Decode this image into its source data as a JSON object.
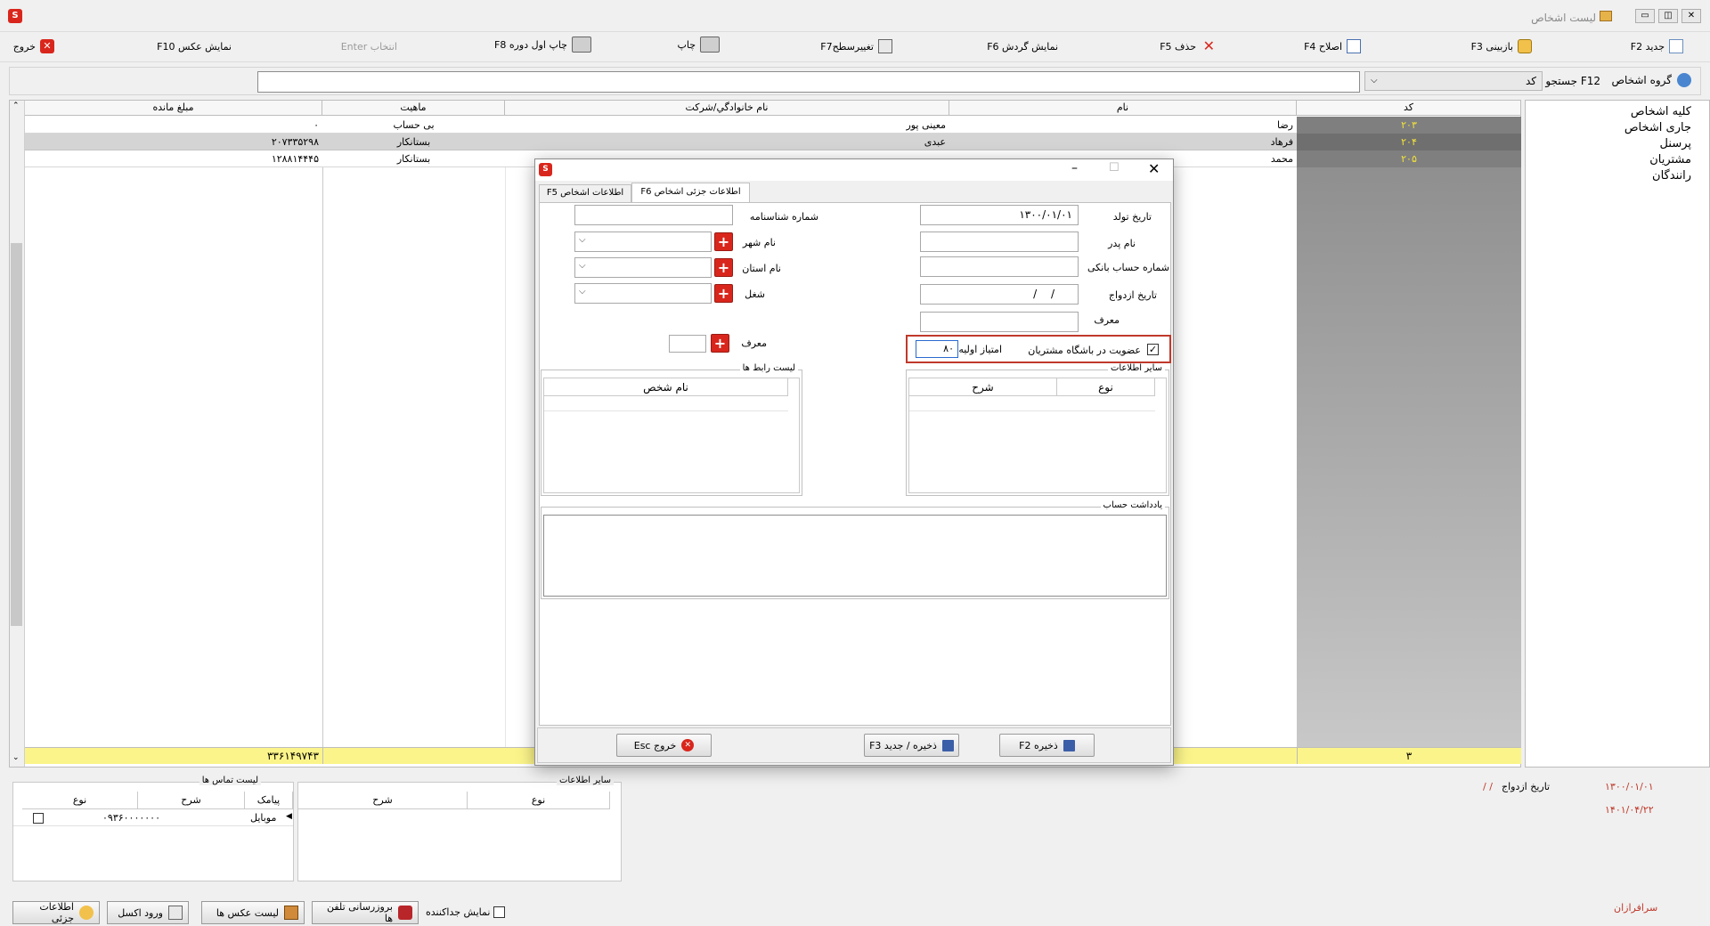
{
  "window": {
    "title": "لیست اشخاص"
  },
  "toolbar": {
    "new": "جدید  F2",
    "review": "بازبینی F3",
    "edit": "اصلاح  F4",
    "delete": "حذف  F5",
    "show_turnover": "نمایش گردش F6",
    "change_level": "تغییرسطحF7",
    "print": "چاپ",
    "print_initial": "چاپ اول دوره F8",
    "select": "انتخاب Enter",
    "show_photo": "نمایش عکس F10",
    "exit": "خروج"
  },
  "search": {
    "group_label": "گروه اشخاص",
    "search_label": "F12 جستجو",
    "type_value": "کد",
    "query": ""
  },
  "grid": {
    "headers": {
      "code": "کد",
      "name": "نام",
      "family": "نام خانوادگي/شرکت",
      "nature": "ماهيت",
      "balance": "مبلغ مانده"
    },
    "rows": [
      {
        "code": "۲۰۳",
        "name": "رضا",
        "family": "معینی پور",
        "nature": "بی حساب",
        "balance": "۰"
      },
      {
        "code": "۲۰۴",
        "name": "فرهاد",
        "family": "عبدی",
        "nature": "بستانکار",
        "balance": "۲۰۷۳۳۵۲۹۸"
      },
      {
        "code": "۲۰۵",
        "name": "محمد",
        "family": "",
        "nature": "بستانکار",
        "balance": "۱۲۸۸۱۴۴۴۵"
      }
    ],
    "footer": {
      "count": "۳",
      "total": "۳۳۶۱۴۹۷۴۳"
    }
  },
  "tree": {
    "items": [
      "کلیه اشخاص",
      "جاری اشخاص",
      "پرسنل",
      "مشتریان",
      "رانندگان"
    ]
  },
  "dialog": {
    "tabs": [
      "اطلاعات جزئی اشخاص F6",
      "اطلاعات اشخاص F5"
    ],
    "fields": {
      "birth_date_label": "تاریخ تولد",
      "birth_date_value": "۱۳۰۰/۰۱/۰۱",
      "father_label": "نام پدر",
      "bank_label": "شماره حساب بانکی",
      "marriage_label": "تاریخ ازدواج",
      "marriage_value": "/ /",
      "referrer_label": "معرف",
      "id_number_label": "شماره شناسنامه",
      "city_label": "نام شهر",
      "province_label": "نام استان",
      "job_label": "شغل",
      "referrer2_label": "معرف",
      "club_label": "عضویت در باشگاه مشتریان",
      "initial_points_label": "امتیاز اولیه",
      "initial_points_value": "۸۰"
    },
    "other_info": {
      "title": "سایر اطلاعات",
      "col_type": "نوع",
      "col_desc": "شرح"
    },
    "contacts": {
      "title": "لیست رابط ها",
      "col_name": "نام شخص"
    },
    "note": {
      "title": "یادداشت حساب"
    },
    "buttons": {
      "save": "ذخیره  F2",
      "save_new": "ذخیره / جدید  F3",
      "exit": "خروج  Esc"
    }
  },
  "bottom": {
    "phone_list": {
      "title": "لیست تماس ها",
      "col_sms": "پیامک",
      "col_desc": "شرح",
      "col_type": "نوع",
      "rows": [
        {
          "type": "موبایل",
          "desc": "۰۹۳۶۰۰۰۰۰۰۰"
        }
      ]
    },
    "other_info": {
      "title": "سایر اطلاعات",
      "col_desc": "شرح",
      "col_type": "نوع"
    },
    "marriage_label": "تاریخ ازدواج",
    "marriage_value": "/ /",
    "date1": "۱۳۰۰/۰۱/۰۱",
    "date2": "۱۴۰۱/۰۴/۲۲",
    "red_text": "سرافرازان"
  },
  "bottom_buttons": {
    "details": "اطلاعات جزئی",
    "excel": "ورود اکسل",
    "photos": "لیست عکس ها",
    "update_phones": "بروزرسانی تلفن ها",
    "show_separator": "نمایش جداکننده"
  }
}
